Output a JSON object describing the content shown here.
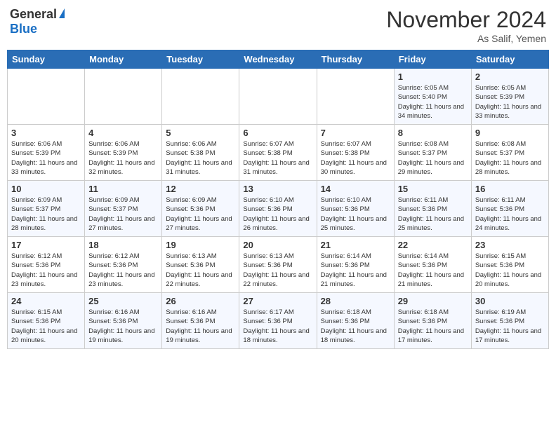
{
  "header": {
    "logo_general": "General",
    "logo_blue": "Blue",
    "month_title": "November 2024",
    "location": "As Salif, Yemen"
  },
  "weekdays": [
    "Sunday",
    "Monday",
    "Tuesday",
    "Wednesday",
    "Thursday",
    "Friday",
    "Saturday"
  ],
  "weeks": [
    {
      "row_class": "row-1",
      "days": [
        {
          "num": "",
          "info": "",
          "empty": true
        },
        {
          "num": "",
          "info": "",
          "empty": true
        },
        {
          "num": "",
          "info": "",
          "empty": true
        },
        {
          "num": "",
          "info": "",
          "empty": true
        },
        {
          "num": "",
          "info": "",
          "empty": true
        },
        {
          "num": "1",
          "info": "Sunrise: 6:05 AM\nSunset: 5:40 PM\nDaylight: 11 hours\nand 34 minutes.",
          "empty": false
        },
        {
          "num": "2",
          "info": "Sunrise: 6:05 AM\nSunset: 5:39 PM\nDaylight: 11 hours\nand 33 minutes.",
          "empty": false
        }
      ]
    },
    {
      "row_class": "row-2",
      "days": [
        {
          "num": "3",
          "info": "Sunrise: 6:06 AM\nSunset: 5:39 PM\nDaylight: 11 hours\nand 33 minutes.",
          "empty": false
        },
        {
          "num": "4",
          "info": "Sunrise: 6:06 AM\nSunset: 5:39 PM\nDaylight: 11 hours\nand 32 minutes.",
          "empty": false
        },
        {
          "num": "5",
          "info": "Sunrise: 6:06 AM\nSunset: 5:38 PM\nDaylight: 11 hours\nand 31 minutes.",
          "empty": false
        },
        {
          "num": "6",
          "info": "Sunrise: 6:07 AM\nSunset: 5:38 PM\nDaylight: 11 hours\nand 31 minutes.",
          "empty": false
        },
        {
          "num": "7",
          "info": "Sunrise: 6:07 AM\nSunset: 5:38 PM\nDaylight: 11 hours\nand 30 minutes.",
          "empty": false
        },
        {
          "num": "8",
          "info": "Sunrise: 6:08 AM\nSunset: 5:37 PM\nDaylight: 11 hours\nand 29 minutes.",
          "empty": false
        },
        {
          "num": "9",
          "info": "Sunrise: 6:08 AM\nSunset: 5:37 PM\nDaylight: 11 hours\nand 28 minutes.",
          "empty": false
        }
      ]
    },
    {
      "row_class": "row-3",
      "days": [
        {
          "num": "10",
          "info": "Sunrise: 6:09 AM\nSunset: 5:37 PM\nDaylight: 11 hours\nand 28 minutes.",
          "empty": false
        },
        {
          "num": "11",
          "info": "Sunrise: 6:09 AM\nSunset: 5:37 PM\nDaylight: 11 hours\nand 27 minutes.",
          "empty": false
        },
        {
          "num": "12",
          "info": "Sunrise: 6:09 AM\nSunset: 5:36 PM\nDaylight: 11 hours\nand 27 minutes.",
          "empty": false
        },
        {
          "num": "13",
          "info": "Sunrise: 6:10 AM\nSunset: 5:36 PM\nDaylight: 11 hours\nand 26 minutes.",
          "empty": false
        },
        {
          "num": "14",
          "info": "Sunrise: 6:10 AM\nSunset: 5:36 PM\nDaylight: 11 hours\nand 25 minutes.",
          "empty": false
        },
        {
          "num": "15",
          "info": "Sunrise: 6:11 AM\nSunset: 5:36 PM\nDaylight: 11 hours\nand 25 minutes.",
          "empty": false
        },
        {
          "num": "16",
          "info": "Sunrise: 6:11 AM\nSunset: 5:36 PM\nDaylight: 11 hours\nand 24 minutes.",
          "empty": false
        }
      ]
    },
    {
      "row_class": "row-4",
      "days": [
        {
          "num": "17",
          "info": "Sunrise: 6:12 AM\nSunset: 5:36 PM\nDaylight: 11 hours\nand 23 minutes.",
          "empty": false
        },
        {
          "num": "18",
          "info": "Sunrise: 6:12 AM\nSunset: 5:36 PM\nDaylight: 11 hours\nand 23 minutes.",
          "empty": false
        },
        {
          "num": "19",
          "info": "Sunrise: 6:13 AM\nSunset: 5:36 PM\nDaylight: 11 hours\nand 22 minutes.",
          "empty": false
        },
        {
          "num": "20",
          "info": "Sunrise: 6:13 AM\nSunset: 5:36 PM\nDaylight: 11 hours\nand 22 minutes.",
          "empty": false
        },
        {
          "num": "21",
          "info": "Sunrise: 6:14 AM\nSunset: 5:36 PM\nDaylight: 11 hours\nand 21 minutes.",
          "empty": false
        },
        {
          "num": "22",
          "info": "Sunrise: 6:14 AM\nSunset: 5:36 PM\nDaylight: 11 hours\nand 21 minutes.",
          "empty": false
        },
        {
          "num": "23",
          "info": "Sunrise: 6:15 AM\nSunset: 5:36 PM\nDaylight: 11 hours\nand 20 minutes.",
          "empty": false
        }
      ]
    },
    {
      "row_class": "row-5",
      "days": [
        {
          "num": "24",
          "info": "Sunrise: 6:15 AM\nSunset: 5:36 PM\nDaylight: 11 hours\nand 20 minutes.",
          "empty": false
        },
        {
          "num": "25",
          "info": "Sunrise: 6:16 AM\nSunset: 5:36 PM\nDaylight: 11 hours\nand 19 minutes.",
          "empty": false
        },
        {
          "num": "26",
          "info": "Sunrise: 6:16 AM\nSunset: 5:36 PM\nDaylight: 11 hours\nand 19 minutes.",
          "empty": false
        },
        {
          "num": "27",
          "info": "Sunrise: 6:17 AM\nSunset: 5:36 PM\nDaylight: 11 hours\nand 18 minutes.",
          "empty": false
        },
        {
          "num": "28",
          "info": "Sunrise: 6:18 AM\nSunset: 5:36 PM\nDaylight: 11 hours\nand 18 minutes.",
          "empty": false
        },
        {
          "num": "29",
          "info": "Sunrise: 6:18 AM\nSunset: 5:36 PM\nDaylight: 11 hours\nand 17 minutes.",
          "empty": false
        },
        {
          "num": "30",
          "info": "Sunrise: 6:19 AM\nSunset: 5:36 PM\nDaylight: 11 hours\nand 17 minutes.",
          "empty": false
        }
      ]
    }
  ]
}
